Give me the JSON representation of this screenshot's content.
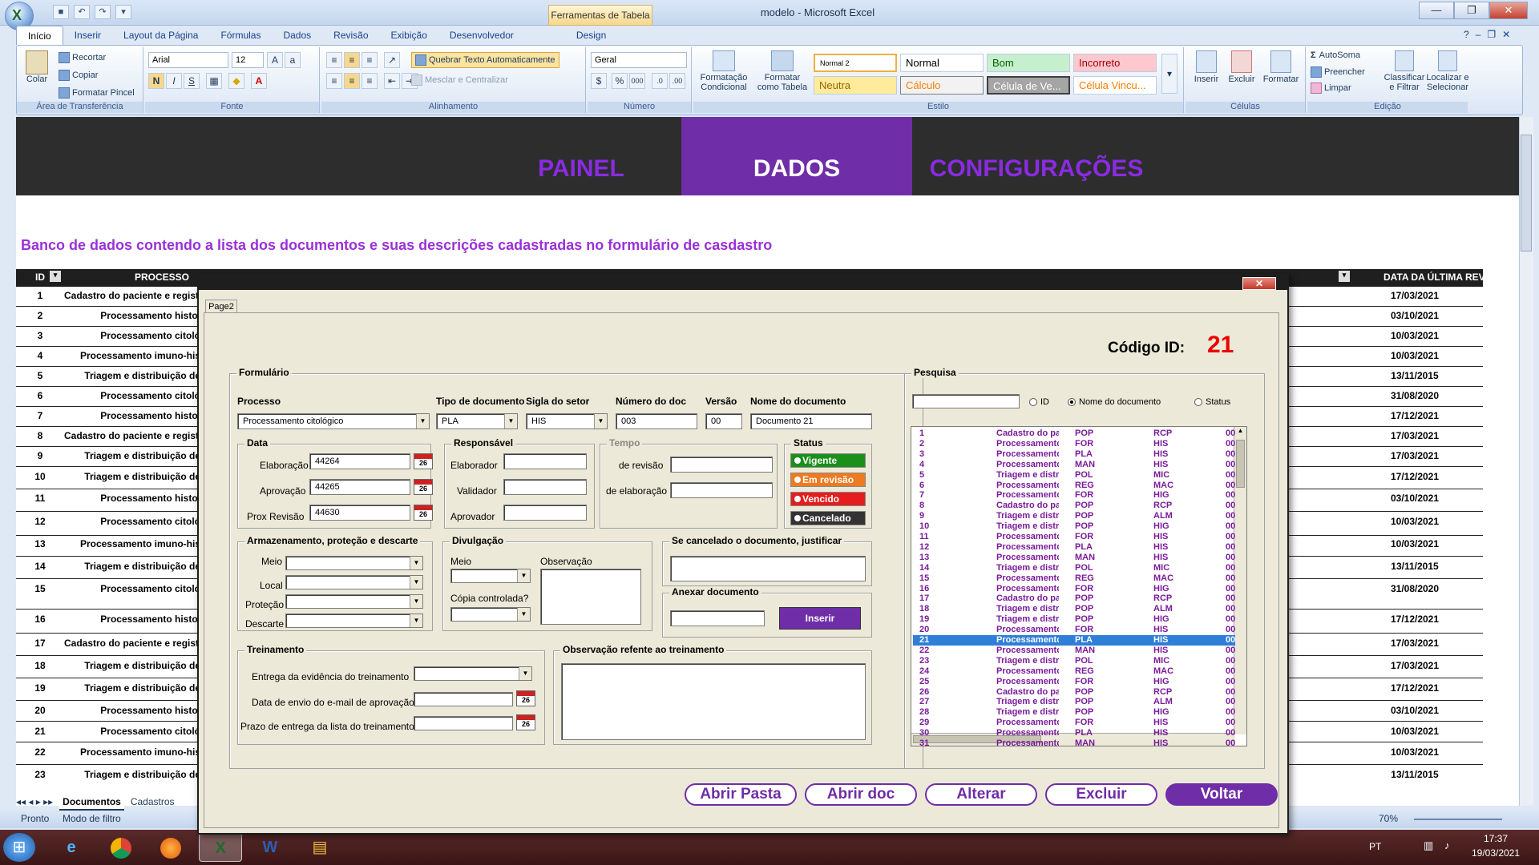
{
  "titlebar": {
    "context_tab": "Ferramentas de Tabela",
    "app_title": "modelo - Microsoft Excel"
  },
  "ribbon_tabs": [
    "Início",
    "Inserir",
    "Layout da Página",
    "Fórmulas",
    "Dados",
    "Revisão",
    "Exibição",
    "Desenvolvedor",
    "Design"
  ],
  "ribbon": {
    "clipboard": {
      "label": "Área de Transferência",
      "paste": "Colar",
      "cut": "Recortar",
      "copy": "Copiar",
      "format_painter": "Formatar Pincel"
    },
    "font": {
      "label": "Fonte",
      "family": "Arial",
      "size": "12",
      "bold": "N",
      "italic": "I",
      "underline": "S"
    },
    "alignment": {
      "label": "Alinhamento",
      "wrap": "Quebrar Texto Automaticamente",
      "merge": "Mesclar e Centralizar"
    },
    "number": {
      "label": "Número",
      "format": "Geral",
      "percent": "%",
      "thousands": "000"
    },
    "styles": {
      "label": "Estilo",
      "cond_format": "Formatação Condicional",
      "format_table": "Formatar como Tabela",
      "cells": [
        "Normal 2",
        "Normal",
        "Bom",
        "Incorreto",
        "Neutra",
        "Cálculo",
        "Célula de Ve...",
        "Célula Vincu..."
      ]
    },
    "cells": {
      "label": "Células",
      "insert": "Inserir",
      "delete": "Excluir",
      "format": "Formatar"
    },
    "editing": {
      "label": "Edição",
      "autosum": "AutoSoma",
      "fill": "Preencher",
      "clear": "Limpar",
      "sort": "Classificar e Filtrar",
      "find": "Localizar e Selecionar"
    }
  },
  "nav": {
    "painel": "PAINEL",
    "dados": "DADOS",
    "config": "CONFIGURAÇÕES"
  },
  "description": "Banco de dados contendo a lista  dos documentos e suas descrições cadastradas no formulário de casdastro",
  "sheet": {
    "col_id": "ID",
    "col_processo": "PROCESSO",
    "col_ultima": "DATA DA ÚLTIMA REVISÃO",
    "rows": [
      {
        "id": "1",
        "proc": "Cadastro do paciente e registr",
        "date": "17/03/2021"
      },
      {
        "id": "2",
        "proc": "Processamento histol",
        "date": "03/10/2021"
      },
      {
        "id": "3",
        "proc": "Processamento citoló",
        "date": "10/03/2021"
      },
      {
        "id": "4",
        "proc": "Processamento imuno-his",
        "date": "10/03/2021"
      },
      {
        "id": "5",
        "proc": "Triagem e distribuição de",
        "date": "13/11/2015"
      },
      {
        "id": "6",
        "proc": "Processamento citoló",
        "date": "31/08/2020"
      },
      {
        "id": "7",
        "proc": "Processamento histol",
        "date": "17/12/2021"
      },
      {
        "id": "8",
        "proc": "Cadastro do paciente e registr",
        "date": "17/03/2021"
      },
      {
        "id": "9",
        "proc": "Triagem e distribuição de",
        "date": "17/03/2021"
      },
      {
        "id": "10",
        "proc": "Triagem e distribuição de",
        "date": "17/12/2021"
      },
      {
        "id": "11",
        "proc": "Processamento histol",
        "date": "03/10/2021"
      },
      {
        "id": "12",
        "proc": "Processamento citoló",
        "date": "10/03/2021"
      },
      {
        "id": "13",
        "proc": "Processamento imuno-his",
        "date": "10/03/2021"
      },
      {
        "id": "14",
        "proc": "Triagem e distribuição de",
        "date": "13/11/2015"
      },
      {
        "id": "15",
        "proc": "Processamento citoló",
        "date": "31/08/2020"
      },
      {
        "id": "16",
        "proc": "Processamento histol",
        "date": "17/12/2021"
      },
      {
        "id": "17",
        "proc": "Cadastro do paciente e registr",
        "date": "17/03/2021"
      },
      {
        "id": "18",
        "proc": "Triagem e distribuição de",
        "date": "17/03/2021"
      },
      {
        "id": "19",
        "proc": "Triagem e distribuição de",
        "date": "17/12/2021"
      },
      {
        "id": "20",
        "proc": "Processamento histol",
        "date": "03/10/2021"
      },
      {
        "id": "21",
        "proc": "Processamento citoló",
        "date": "10/03/2021"
      },
      {
        "id": "22",
        "proc": "Processamento imuno-his",
        "date": "10/03/2021"
      },
      {
        "id": "23",
        "proc": "Triagem e distribuição de",
        "date": "13/11/2015"
      }
    ]
  },
  "sheet_tabs": [
    "Documentos",
    "Cadastros"
  ],
  "status": {
    "ready": "Pronto",
    "mode": "Modo de filtro",
    "zoom": "70%"
  },
  "taskbar": {
    "lang": "PT",
    "time": "17:37",
    "date": "19/03/2021"
  },
  "form": {
    "page_tab": "Page2",
    "codigo_label": "Código ID:",
    "codigo_value": "21",
    "formulario": "Formulário",
    "processo_label": "Processo",
    "processo_value": "Processamento citológico",
    "tipo_label": "Tipo de documento",
    "tipo_value": "PLA",
    "sigla_label": "Sigla do setor",
    "sigla_value": "HIS",
    "numero_label": "Número do doc",
    "numero_value": "003",
    "versao_label": "Versão",
    "versao_value": "00",
    "nome_label": "Nome do documento",
    "nome_value": "Documento 21",
    "data": {
      "title": "Data",
      "elab_label": "Elaboração",
      "elab": "44264",
      "aprov_label": "Aprovação",
      "aprov": "44265",
      "prox_label": "Prox Revisão",
      "prox": "44630",
      "cal": "26"
    },
    "resp": {
      "title": "Responsável",
      "elab": "Elaborador",
      "valid": "Validador",
      "aprov": "Aprovador"
    },
    "tempo": {
      "title": "Tempo",
      "rev": "de revisão",
      "elab": "de elaboração"
    },
    "status": {
      "title": "Status",
      "vigente": "Vigente",
      "revisao": "Em revisão",
      "vencido": "Vencido",
      "cancelado": "Cancelado"
    },
    "armaz": {
      "title": "Armazenamento, proteção e descarte",
      "meio": "Meio",
      "local": "Local",
      "protecao": "Proteção",
      "descarte": "Descarte"
    },
    "divulg": {
      "title": "Divulgação",
      "meio": "Meio",
      "obs": "Observação",
      "copia": "Cópia controlada?"
    },
    "cancel_title": "Se cancelado o documento, justificar",
    "anexar_title": "Anexar documento",
    "inserir": "Inserir",
    "trein": {
      "title": "Treinamento",
      "entrega": "Entrega da evidência do treinamento",
      "envio": "Data de envio do e-mail de aprovação",
      "prazo": "Prazo de entrega da lista do treinamento"
    },
    "obs_trein": "Observação refente ao treinamento",
    "pesquisa": {
      "title": "Pesquisa",
      "opt_id": "ID",
      "opt_nome": "Nome do documento",
      "opt_status": "Status"
    },
    "list": [
      [
        "1",
        "Cadastro do pa",
        "POP",
        "RCP",
        "00"
      ],
      [
        "2",
        "Processamento",
        "FOR",
        "HIS",
        "00"
      ],
      [
        "3",
        "Processamento",
        "PLA",
        "HIS",
        "00"
      ],
      [
        "4",
        "Processamento",
        "MAN",
        "HIS",
        "00"
      ],
      [
        "5",
        "Triagem e distr",
        "POL",
        "MIC",
        "00"
      ],
      [
        "6",
        "Processamento",
        "REG",
        "MAC",
        "00"
      ],
      [
        "7",
        "Processamento",
        "FOR",
        "HIG",
        "00"
      ],
      [
        "8",
        "Cadastro do pa",
        "POP",
        "RCP",
        "00"
      ],
      [
        "9",
        "Triagem e distr",
        "POP",
        "ALM",
        "00"
      ],
      [
        "10",
        "Triagem e distr",
        "POP",
        "HIG",
        "00"
      ],
      [
        "11",
        "Processamento",
        "FOR",
        "HIS",
        "00"
      ],
      [
        "12",
        "Processamento",
        "PLA",
        "HIS",
        "00"
      ],
      [
        "13",
        "Processamento",
        "MAN",
        "HIS",
        "00"
      ],
      [
        "14",
        "Triagem e distr",
        "POL",
        "MIC",
        "00"
      ],
      [
        "15",
        "Processamento",
        "REG",
        "MAC",
        "00"
      ],
      [
        "16",
        "Processamento",
        "FOR",
        "HIG",
        "00"
      ],
      [
        "17",
        "Cadastro do pa",
        "POP",
        "RCP",
        "00"
      ],
      [
        "18",
        "Triagem e distr",
        "POP",
        "ALM",
        "00"
      ],
      [
        "19",
        "Triagem e distr",
        "POP",
        "HIG",
        "00"
      ],
      [
        "20",
        "Processamento",
        "FOR",
        "HIS",
        "00"
      ],
      [
        "21",
        "Processamento",
        "PLA",
        "HIS",
        "00"
      ],
      [
        "22",
        "Processamento",
        "MAN",
        "HIS",
        "00"
      ],
      [
        "23",
        "Triagem e distr",
        "POL",
        "MIC",
        "00"
      ],
      [
        "24",
        "Processamento",
        "REG",
        "MAC",
        "00"
      ],
      [
        "25",
        "Processamento",
        "FOR",
        "HIG",
        "00"
      ],
      [
        "26",
        "Cadastro do pa",
        "POP",
        "RCP",
        "00"
      ],
      [
        "27",
        "Triagem e distr",
        "POP",
        "ALM",
        "00"
      ],
      [
        "28",
        "Triagem e distr",
        "POP",
        "HIG",
        "00"
      ],
      [
        "29",
        "Processamento",
        "FOR",
        "HIS",
        "00"
      ],
      [
        "30",
        "Processamento",
        "PLA",
        "HIS",
        "00"
      ],
      [
        "31",
        "Processamento",
        "MAN",
        "HIS",
        "00"
      ]
    ],
    "selected": "21",
    "buttons": {
      "abrir_pasta": "Abrir Pasta",
      "abrir_doc": "Abrir doc",
      "alterar": "Alterar",
      "excluir": "Excluir",
      "voltar": "Voltar"
    }
  }
}
